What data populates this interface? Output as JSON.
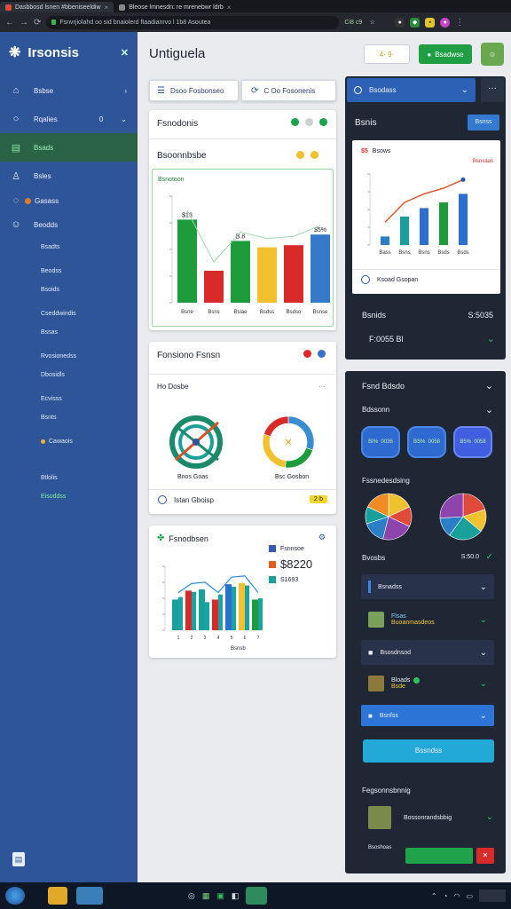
{
  "browser": {
    "tabs": [
      {
        "label": "Dasbbosd lsnen #bbeniseeldiw"
      },
      {
        "label": "Bleose lmnesdn: re mrenebwr ldrb"
      }
    ],
    "url": "Fsnvrjiolahd oo sid bnaiolerd ftaadianrvo l 1b8 Asoutea",
    "ext_text": "Ci8 c9"
  },
  "sidebar": {
    "app_name": "Irsonsis",
    "items": [
      {
        "label": "Bsbse",
        "icon": "home-icon"
      },
      {
        "label": "Rqalies",
        "icon": "circle-icon",
        "badge": "0"
      },
      {
        "label": "Bsads",
        "icon": "chart-icon"
      },
      {
        "label": "Bsles",
        "icon": "users-icon"
      },
      {
        "label": "Gasass",
        "icon": "chat-icon"
      },
      {
        "label": "Beodds",
        "icon": "user-icon"
      }
    ],
    "subitems": [
      "Bsadts",
      "Beodss",
      "Bsoids",
      "Cseddwindis",
      "Bssas",
      "Rvosionedss",
      "Dbosidls",
      "Ecvisss",
      "Bsnts",
      "Cawaois",
      "Btlolis",
      "Eisoddss"
    ],
    "footer_icon": "doc-icon"
  },
  "header": {
    "title": "Untiguela",
    "btn1": "4· 9·",
    "btn2": "Bsadwse"
  },
  "toolbar": {
    "btn_left": "Dsoo Fosbonseo",
    "btn_right": "C Oo Fosonenis"
  },
  "card1": {
    "title": "Fsnodonis",
    "subtitle": "Bsoonnbsbe",
    "chart_label": "Bsnotoon"
  },
  "card2": {
    "title": "Fonsiono Fsnsn",
    "subtitle": "Ho Dosbe",
    "chip_left": "Bnos Goas",
    "chip_right": "Bsc Gosbon",
    "footer_text": "Istan Gboisp",
    "footer_badge": "2·b"
  },
  "card3": {
    "title": "Fsnodbsen",
    "legend": [
      {
        "label": "Fsnnsoe",
        "color": "#3a58b8"
      },
      {
        "label": "$8220",
        "color": "#e45d20"
      },
      {
        "label": "S1693",
        "color": "#19a09a"
      }
    ],
    "xlabel": "Bsnsb"
  },
  "right": {
    "dropdown": "Bsodass",
    "header": "Bsnis",
    "header_btn": "Bsnss",
    "chart_title": "Bsows",
    "chart_tag": "Bsnsaas",
    "chart_footer": "Ksoad Gsopan",
    "stat_label": "Bsnids",
    "stat_value": "S:5035",
    "stat_sub": "F:0055 Bl"
  },
  "right2": {
    "title": "Fsnd Bdsdo",
    "sub1": "Bdssonn",
    "pills": [
      "BI%  0036",
      "BS%  0058",
      "B5%  0058"
    ],
    "section2": "Fssnedesdsing",
    "stat_label": "Bvosbs",
    "stat_value": "S:50.0",
    "list": [
      {
        "label": "Bsnadss"
      },
      {
        "label": "Flsas",
        "sub": "Buoanmasdeos"
      },
      {
        "label": "Bsosdnsod"
      },
      {
        "label": "Bloads",
        "sub": "Bsde"
      },
      {
        "label": "Bsnfss"
      }
    ],
    "action_btn": "Bssndss",
    "section3": "Fegsonnsbnnig",
    "item3": "Bossonrandsbbig",
    "footer_label": "Bsoshoas"
  },
  "colors": {
    "sidebar": "#2d5597",
    "accent_green": "#1fa34a",
    "dark_panel": "#1f2735",
    "cyan_button": "#23a9d8"
  },
  "chart_data": [
    {
      "type": "bar",
      "categories": [
        "Bsne",
        "Bsns",
        "Bslae",
        "Bsdss",
        "Bsdso",
        "Bsnse"
      ],
      "values": [
        78,
        30,
        58,
        52,
        54,
        64
      ],
      "data_labels": [
        "$13",
        "",
        "B.8",
        "",
        "",
        "$5%"
      ],
      "ylim": [
        0,
        100
      ],
      "colors": [
        "#1e9b3a",
        "#d92a2a",
        "#1e9b3a",
        "#f2c12e",
        "#d92a2a",
        "#3579c9"
      ]
    },
    {
      "type": "bar",
      "categories": [
        "Bass",
        "Bsns",
        "Bsns",
        "Bsds",
        "Bsds"
      ],
      "values": [
        12,
        40,
        52,
        60,
        72
      ],
      "ylim": [
        0,
        100
      ],
      "colors": [
        "#2b7fc7",
        "#19a09a",
        "#2b6fd0",
        "#1e9b3a",
        "#2b6fd0"
      ]
    },
    {
      "type": "bar",
      "series": [
        {
          "name": "Fsnnsoe",
          "values": [
            48,
            62,
            64,
            48,
            72,
            74,
            48
          ]
        },
        {
          "name": "$8220",
          "values": [
            34,
            30,
            32,
            48,
            38,
            42,
            66
          ]
        },
        {
          "name": "S1693",
          "values": [
            52,
            60,
            44,
            56,
            68,
            70,
            50
          ]
        }
      ],
      "categories": [
        "1",
        "2",
        "3",
        "4",
        "5",
        "6",
        "7"
      ],
      "ylim": [
        0,
        100
      ]
    },
    {
      "type": "pie",
      "values": [
        18,
        14,
        22,
        16,
        12,
        18
      ],
      "colors": [
        "#f2c12e",
        "#e04a3b",
        "#8e44ad",
        "#2b7fc7",
        "#19a09a",
        "#f08a24"
      ]
    },
    {
      "type": "pie",
      "values": [
        20,
        16,
        24,
        14,
        26
      ],
      "colors": [
        "#e04a3b",
        "#f2c12e",
        "#19a09a",
        "#2b7fc7",
        "#8e44ad"
      ]
    },
    {
      "type": "pie",
      "values": [
        30,
        22,
        28,
        20
      ],
      "colors": [
        "#3a8dd1",
        "#1e9b3a",
        "#f2c12e",
        "#d92a2a"
      ]
    }
  ]
}
